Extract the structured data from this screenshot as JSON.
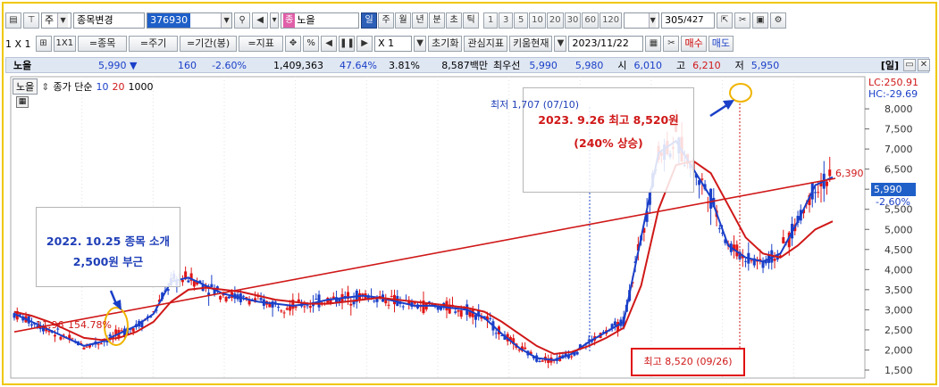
{
  "toolbar1": {
    "period_select": "주",
    "code_change": "종목변경",
    "stock_code": "376930",
    "type_tag": "종",
    "stock_name": "노을",
    "periods": [
      "일",
      "주",
      "월",
      "년",
      "분",
      "초",
      "틱"
    ],
    "active_period": "일",
    "minute_intervals": [
      "1",
      "3",
      "5",
      "10",
      "20",
      "30",
      "60",
      "120"
    ],
    "bar_count": "305",
    "bar_total": "/427"
  },
  "toolbar2": {
    "ratio": "1 X 1",
    "layout": "1X1",
    "btn_stock": "=종목",
    "btn_period": "=주기",
    "btn_range": "=기간(봉)",
    "btn_indicator": "=지표",
    "percent": "%",
    "zoom": "X 1",
    "reset": "초기화",
    "watch_indicator": "관심지표",
    "kiwoom_now": "키움현재",
    "date": "2023/11/22",
    "buy": "매수",
    "sell": "매도"
  },
  "quote": {
    "name": "노을",
    "price": "5,990 ▼",
    "change": "160",
    "change_pct": "-2.60%",
    "volume": "1,409,363",
    "vol_ratio": "47.64%",
    "turnover": "3.81%",
    "amount": "8,587백만",
    "best_ask_label": "최우선",
    "best_ask": "5,990",
    "best_bid": "5,980",
    "open_label": "시",
    "open": "6,010",
    "high_label": "고",
    "high": "6,210",
    "low_label": "저",
    "low": "5,950",
    "window_label": "[일]"
  },
  "legend": {
    "name": "노을",
    "desc": "종가 단순",
    "ma1": "10",
    "ma2": "20",
    "ma3": "1000"
  },
  "right_labels": {
    "lc": "LC:250.91",
    "hc": "HC:-29.69",
    "price_tag": "5,990",
    "price_pct": "-2.60%",
    "high_mark": "6,390",
    "left_mark": "11.96",
    "left_pct": "154.78%"
  },
  "annotations": {
    "left_line1": "2022. 10.25 종목 소개",
    "left_line2": "2,500원 부근",
    "right_line1": "2023. 9.26 최고 8,520원",
    "right_line2": "(240% 상승)",
    "low_label": "최저 1,707 (07/10)",
    "max_label": "최고 8,520 (09/26)"
  },
  "chart_data": {
    "type": "line",
    "y_ticks": [
      "8,000",
      "7,500",
      "7,000",
      "6,500",
      "6,000",
      "5,500",
      "5,000",
      "4,500",
      "4,000",
      "3,500",
      "3,000",
      "2,500",
      "2,000",
      "1,500"
    ],
    "ylim": [
      1300,
      8800
    ],
    "series": [
      {
        "name": "10",
        "color": "#1a3fc8",
        "values": [
          2900,
          2700,
          2500,
          2300,
          2100,
          2200,
          2400,
          2600,
          2900,
          3700,
          3800,
          3600,
          3400,
          3300,
          3200,
          3150,
          3100,
          3150,
          3250,
          3300,
          3350,
          3300,
          3200,
          3100,
          3100,
          3050,
          3000,
          2800,
          2400,
          2050,
          1800,
          1750,
          1900,
          2200,
          2450,
          2700,
          4800,
          6900,
          7200,
          6500,
          5800,
          4600,
          4300,
          4200,
          4400,
          5200,
          6100,
          6300
        ]
      },
      {
        "name": "20",
        "color": "#d01818",
        "values": [
          2950,
          2850,
          2700,
          2500,
          2300,
          2250,
          2300,
          2450,
          2700,
          3200,
          3500,
          3550,
          3500,
          3450,
          3350,
          3250,
          3200,
          3150,
          3150,
          3200,
          3250,
          3300,
          3250,
          3200,
          3150,
          3100,
          3050,
          2950,
          2700,
          2400,
          2100,
          1900,
          1950,
          2100,
          2300,
          2550,
          3600,
          5500,
          6600,
          6700,
          6400,
          5600,
          4800,
          4400,
          4300,
          4600,
          5000,
          5200
        ]
      }
    ],
    "trendline": {
      "from": 2450,
      "to": 6390
    }
  }
}
